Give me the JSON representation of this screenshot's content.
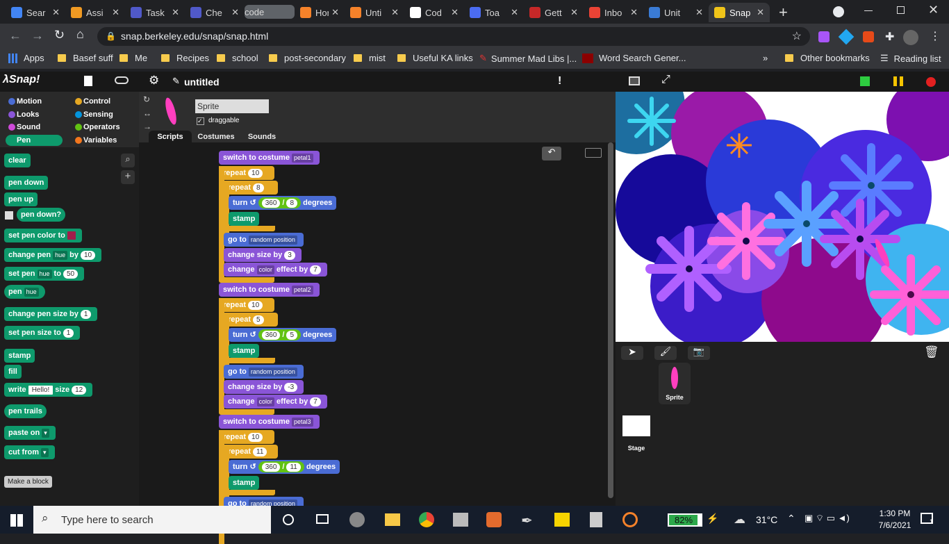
{
  "browser": {
    "tabs": [
      {
        "label": "Sear",
        "color": "#4285f4"
      },
      {
        "label": "Assi",
        "color": "#f09a23"
      },
      {
        "label": "Task",
        "color": "#5059c9"
      },
      {
        "label": "Che",
        "color": "#5059c9"
      },
      {
        "label": "code",
        "color": "#555"
      },
      {
        "label": "Hon",
        "color": "#f5822a"
      },
      {
        "label": "Unti",
        "color": "#f5822a"
      },
      {
        "label": "Cod",
        "color": "#fff"
      },
      {
        "label": "Toa",
        "color": "#4b6cf2"
      },
      {
        "label": "Gett",
        "color": "#c62828"
      },
      {
        "label": "Inbo",
        "color": "#ea4335"
      },
      {
        "label": "Unit",
        "color": "#3a7bd5"
      },
      {
        "label": "Snap",
        "color": "#f0c419"
      }
    ],
    "url": "snap.berkeley.edu/snap/snap.html",
    "bookmarks": [
      "Apps",
      "Basef suff",
      "Me",
      "Recipes",
      "school",
      "post-secondary",
      "mist",
      "Useful KA links",
      "Summer Mad Libs |...",
      "Word Search Gener..."
    ],
    "other_bookmarks": "Other bookmarks",
    "reading_list": "Reading list",
    "more": "»"
  },
  "snap": {
    "logo": "Snap!",
    "project_title": "untitled",
    "categories": [
      {
        "label": "Motion",
        "color": "#4a6cd4"
      },
      {
        "label": "Control",
        "color": "#e6a822"
      },
      {
        "label": "Looks",
        "color": "#8a55d7"
      },
      {
        "label": "Sensing",
        "color": "#0494dc"
      },
      {
        "label": "Sound",
        "color": "#cf4ad9"
      },
      {
        "label": "Operators",
        "color": "#62c213"
      },
      {
        "label": "Pen",
        "color": "#0e9a6c"
      },
      {
        "label": "Variables",
        "color": "#f3761d"
      }
    ],
    "palette": {
      "clear": "clear",
      "pen_down": "pen down",
      "pen_up": "pen up",
      "pen_down_q": "pen down?",
      "set_pen_color": "set pen color to",
      "change_pen": "change pen",
      "hue": "hue",
      "by": "by",
      "ten": "10",
      "set_pen": "set pen",
      "to": "to",
      "fifty": "50",
      "pen": "pen",
      "change_pen_size": "change pen size by",
      "one": "1",
      "set_pen_size": "set pen size to",
      "stamp": "stamp",
      "fill": "fill",
      "write": "write",
      "hello": "Hello!",
      "size": "size",
      "twelve": "12",
      "pen_trails": "pen trails",
      "paste_on": "paste on",
      "cut_from": "cut from",
      "make_block": "Make a block"
    },
    "sprite": {
      "name": "Sprite",
      "draggable": "draggable",
      "tabs": [
        "Scripts",
        "Costumes",
        "Sounds"
      ]
    },
    "script": {
      "switch": "switch to costume",
      "repeat": "repeat",
      "turn": "turn",
      "degrees": "degrees",
      "stamp": "stamp",
      "go_to": "go to",
      "random": "random position",
      "change_size": "change size by",
      "change": "change",
      "color": "color",
      "effect_by": "effect by",
      "n360": "360",
      "slash": "/",
      "groups": [
        {
          "costume": "petal1",
          "outer": "10",
          "inner": "8",
          "size": "3",
          "effect": "7"
        },
        {
          "costume": "petal2",
          "outer": "10",
          "inner": "5",
          "size": "-3",
          "effect": "7"
        },
        {
          "costume": "petal3",
          "outer": "10",
          "inner": "11",
          "size": "",
          "effect": ""
        }
      ]
    },
    "corral": {
      "sprite_label": "Sprite",
      "stage_label": "Stage"
    }
  },
  "taskbar": {
    "search": "Type here to search",
    "battery": "82%",
    "weather": "31°C",
    "time": "1:30 PM",
    "date": "7/6/2021",
    "notif": "1"
  }
}
